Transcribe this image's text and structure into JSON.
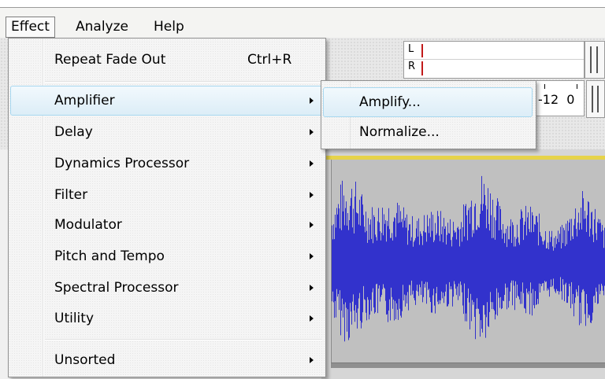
{
  "menubar": {
    "items": [
      "Effect",
      "Analyze",
      "Help"
    ]
  },
  "effect_menu": {
    "items": [
      {
        "label": "Repeat Fade Out",
        "shortcut": "Ctrl+R",
        "submenu": false
      },
      {
        "label": "Amplifier",
        "submenu": true,
        "highlighted": true
      },
      {
        "label": "Delay",
        "submenu": true
      },
      {
        "label": "Dynamics Processor",
        "submenu": true
      },
      {
        "label": "Filter",
        "submenu": true
      },
      {
        "label": "Modulator",
        "submenu": true
      },
      {
        "label": "Pitch and Tempo",
        "submenu": true
      },
      {
        "label": "Spectral Processor",
        "submenu": true
      },
      {
        "label": "Utility",
        "submenu": true
      },
      {
        "label": "Unsorted",
        "submenu": true
      }
    ]
  },
  "amplifier_submenu": {
    "items": [
      {
        "label": "Amplify...",
        "highlighted": true
      },
      {
        "label": "Normalize..."
      }
    ]
  },
  "meter": {
    "left_label": "L",
    "right_label": "R",
    "scale_text": "-12  0"
  },
  "colors": {
    "waveform": "#3232cc",
    "track_background": "#c0c0c0",
    "selection_line": "#e6d34a",
    "highlight_border": "#a8d8f0",
    "meter_marker": "#c11a1a"
  }
}
